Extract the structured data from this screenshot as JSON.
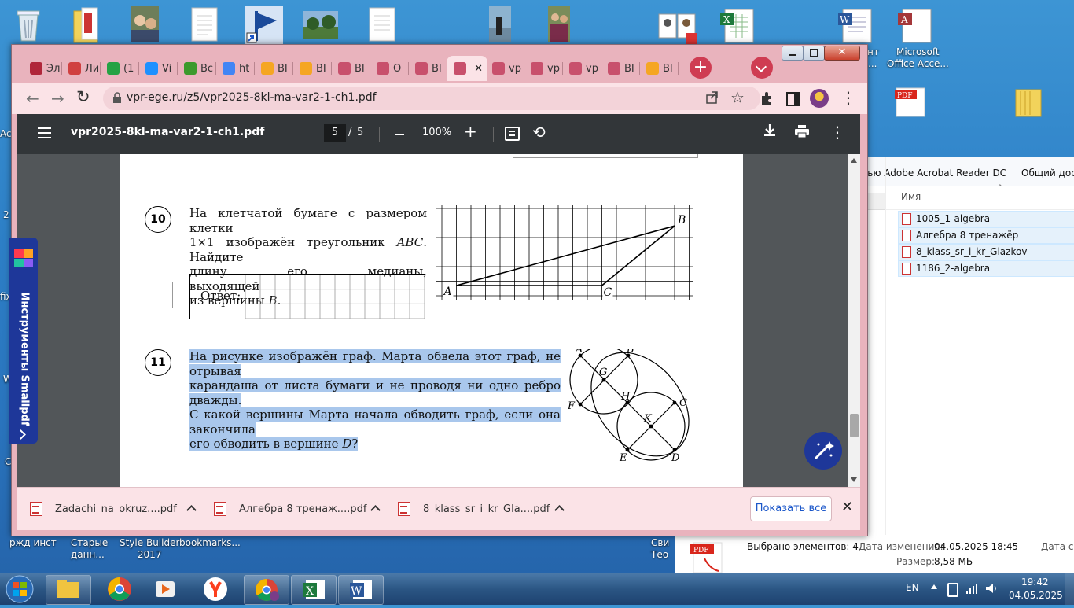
{
  "desktop": {
    "icons_top_labels": {
      "right_a": "Microsoft",
      "right_b": "Office Acce...",
      "right_partial": "нт",
      "right_partial2": "..."
    },
    "left_edge_labels": [
      "Ac",
      "2",
      "fix",
      "W",
      "C"
    ],
    "bottom_labels": [
      "ржд инст",
      "Старые\nданн...",
      "Style Builder\n2017",
      "bookmarks...",
      "Сви\nТео"
    ]
  },
  "browser": {
    "tabs": [
      {
        "label": "Эл",
        "color": "#b0263a"
      },
      {
        "label": "Ли",
        "color": "#d04040"
      },
      {
        "label": "(1",
        "color": "#25a244"
      },
      {
        "label": "Vi",
        "color": "#1e90ff"
      },
      {
        "label": "Bc",
        "color": "#3c9a2c"
      },
      {
        "label": "ht",
        "color": "#4285f4"
      },
      {
        "label": "ВI",
        "color": "#f5a623"
      },
      {
        "label": "ВI",
        "color": "#f5a623"
      },
      {
        "label": "ВI",
        "color": "#c8506c"
      },
      {
        "label": "О",
        "color": "#c8506c"
      },
      {
        "label": "ВI",
        "color": "#c8506c"
      },
      {
        "label": "",
        "color": "#c8506c"
      },
      {
        "label": "vp",
        "color": "#c8506c"
      },
      {
        "label": "vp",
        "color": "#c8506c"
      },
      {
        "label": "vp",
        "color": "#c8506c"
      },
      {
        "label": "ВI",
        "color": "#c8506c"
      },
      {
        "label": "ВI",
        "color": "#f5a623"
      }
    ],
    "url": "vpr-ege.ru/z5/vpr2025-8kl-ma-var2-1-ch1.pdf"
  },
  "pdf": {
    "filename": "vpr2025-8kl-ma-var2-1-ch1.pdf",
    "page_current": "5",
    "page_sep": "/",
    "page_total": "5",
    "zoom": "100%"
  },
  "task10": {
    "number": "10",
    "text_line1": "На клетчатой бумаге с размером клетки",
    "text_line2a": "1×1 изображён треугольник ",
    "text_line2b": "ABC",
    "text_line2c": ". Найдите",
    "text_line3": "длину его медианы, выходящей",
    "text_line4a": "из вершины ",
    "text_line4b": "B",
    "text_line4c": ".",
    "answer_label": "Ответ:",
    "vertex_a": "A",
    "vertex_b": "B",
    "vertex_c": "C"
  },
  "task11": {
    "number": "11",
    "line1": "На рисунке изображён граф. Марта обвела этот граф, не отрывая",
    "line2": "карандаша от листа бумаги и не проводя ни одно ребро дважды.",
    "line3": "С какой вершины Марта начала обводить граф, если она закончила",
    "line4a": "его обводить в вершине ",
    "line4b": "D",
    "line4c": "?",
    "nodes": {
      "A": "A",
      "B": "B",
      "C": "C",
      "D": "D",
      "E": "E",
      "F": "F",
      "G": "G",
      "H": "H",
      "K": "K"
    }
  },
  "smallpdf_panel": "Инструменты Smallpdf",
  "downloads": [
    {
      "name": "Zadachi_na_okruz....pdf"
    },
    {
      "name": "Алгебра 8 тренаж....pdf"
    },
    {
      "name": "8_klass_sr_i_kr_Gla....pdf"
    }
  ],
  "downloads_show_all": "Показать все",
  "explorer": {
    "toolbar_a": "щью Adobe Acrobat Reader DC",
    "toolbar_b": "Общий дост",
    "col_name": "Имя",
    "files": [
      "1005_1-algebra",
      "Алгебра 8 тренажёр",
      "8_klass_sr_i_kr_Glazkov",
      "1186_2-algebra"
    ],
    "status_selected": "Выбрано элементов: 4",
    "status_modified_label": "Дата изменения:",
    "status_modified": "04.05.2025 18:45",
    "status_size_label": "Размер:",
    "status_size": "8,58 МБ",
    "status_date_col": "Дата со"
  },
  "taskbar": {
    "lang": "EN",
    "time": "19:42",
    "date": "04.05.2025"
  }
}
